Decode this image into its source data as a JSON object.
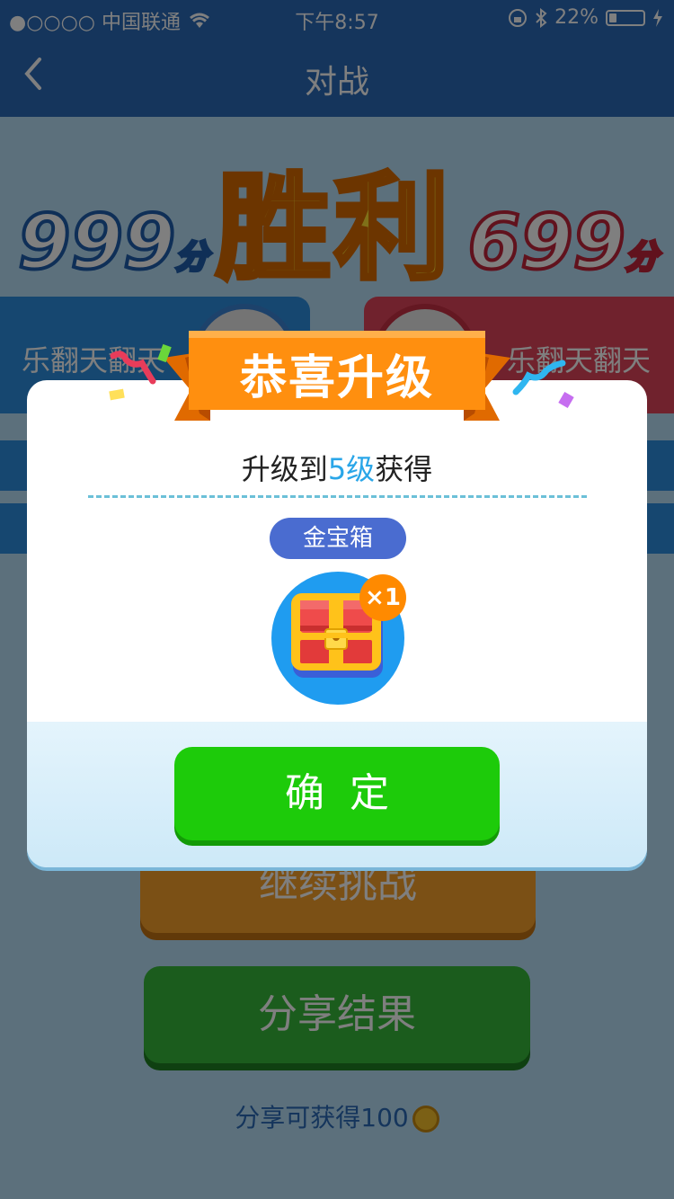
{
  "status_bar": {
    "carrier": "●○○○○ 中国联通",
    "time": "下午8:57",
    "battery": "22%",
    "battery_level": 0.22
  },
  "nav": {
    "title": "对战"
  },
  "result": {
    "left_score": "999",
    "right_score": "699",
    "score_unit": "分",
    "title": "胜利"
  },
  "players": {
    "left_name": "乐翻天翻天",
    "right_name": "乐翻天翻天"
  },
  "actions": {
    "continue_label": "继续挑战",
    "share_label": "分享结果",
    "share_hint": "分享可获得100"
  },
  "modal": {
    "title": "恭喜升级",
    "subtitle_prefix": "升级到",
    "level": "5级",
    "subtitle_suffix": "获得",
    "reward_name": "金宝箱",
    "reward_count": "×1",
    "confirm_label": "确定"
  },
  "colors": {
    "primary_blue": "#2a6bb8",
    "confirm_green": "#1dcb0a",
    "ribbon_orange": "#ff8a00",
    "level_blue": "#2aa6e8"
  }
}
